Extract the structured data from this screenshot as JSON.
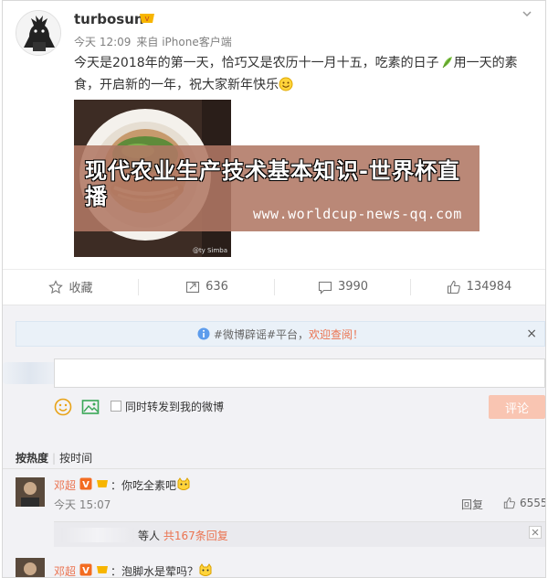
{
  "post": {
    "username": "turbosun",
    "time": "今天 12:09",
    "source": "来自 iPhone客户端",
    "text_part1": "今天是2018年的第一天，恰巧又是农历十一月十五，吃素的日子",
    "text_part2": "用一天的素食，开启新的一年，祝大家新年快乐",
    "image_credit": "@ty Simba",
    "overlay_title": "现代农业生产技术基本知识-世界杯直播",
    "overlay_url": "www.worldcup-news-qq.com"
  },
  "actions": {
    "favorite_label": "收藏",
    "repost_count": "636",
    "comment_count": "3990",
    "like_count": "134984"
  },
  "notice": {
    "prefix": "#微博辟谣#平台，",
    "link": "欢迎查阅！",
    "close": "×"
  },
  "compose": {
    "input_value": "",
    "repost_label": "同时转发到我的微博",
    "submit_label": "评论"
  },
  "sort": {
    "by_hot": "按热度",
    "by_time": "按时间"
  },
  "comments": [
    {
      "name": "邓超",
      "text": "：你吃全素吧",
      "time": "今天 15:07",
      "reply_label": "回复",
      "likes": "6555",
      "sub_text": "等人",
      "sub_link": "共167条回复"
    },
    {
      "name": "邓超",
      "text": "：泡脚水是荤吗？"
    }
  ],
  "colors": {
    "accent": "#eb7350",
    "submit_disabled": "#f9c5b2",
    "overlay": "#b07864"
  }
}
